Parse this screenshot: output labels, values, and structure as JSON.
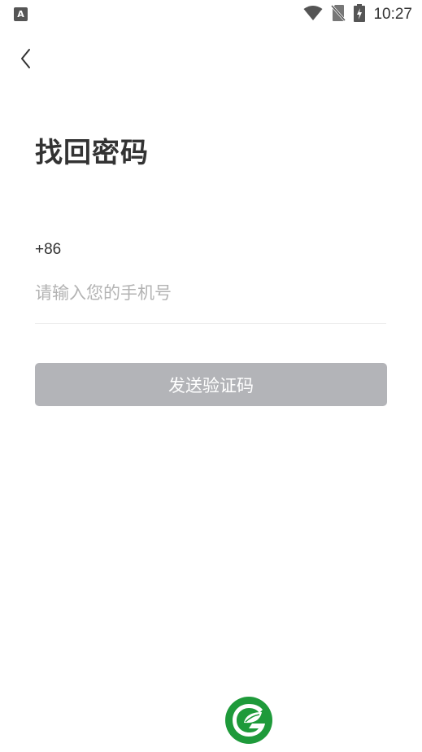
{
  "status_bar": {
    "left_icon": "A",
    "time": "10:27",
    "icons": [
      "notification-a-icon",
      "wifi-icon",
      "no-sim-icon",
      "battery-charging-icon"
    ]
  },
  "header": {
    "back_icon": "chevron-left-icon"
  },
  "main": {
    "title": "找回密码",
    "country_code": "+86",
    "phone_placeholder": "请输入您的手机号",
    "phone_value": "",
    "send_code_label": "发送验证码"
  },
  "footer": {
    "logo_icon": "leaf-logo-icon"
  },
  "colors": {
    "button_disabled": "#b3b4b8",
    "text_primary": "#333333",
    "placeholder": "#b3b3b3",
    "brand_green": "#1e9a3a"
  }
}
